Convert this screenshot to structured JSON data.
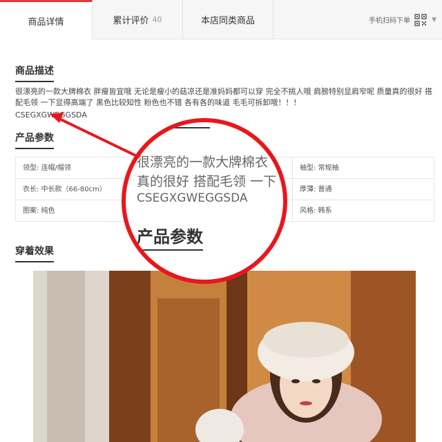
{
  "tabs": [
    {
      "label": "商品详情",
      "count": "",
      "active": true
    },
    {
      "label": "累计评价",
      "count": "40",
      "active": false
    },
    {
      "label": "本店同类商品",
      "count": "",
      "active": false
    }
  ],
  "qr": {
    "label": "手机扫码下单"
  },
  "description": {
    "title": "商品描述",
    "text": "很漂亮的一款大牌棉衣 胖瘦皆宜哦 无论是瘦小的菇凉还是准妈妈都可以穿 完全不挑人哦 肩膀特别显肩窄呢 质量真的很好 搭配毛领 一下显得高端了 黑色比较知性 粉色也不错 各有各的味道 毛毛可拆卸哦！！！",
    "code": "CSEGXGWEGGSDA"
  },
  "params": {
    "title": "产品参数",
    "rows": [
      [
        "领型: 连帽/帽领",
        "",
        "袖型: 常规袖"
      ],
      [
        "衣长: 中长款（66-80cm）",
        "",
        "厚薄: 普通"
      ],
      [
        "图案: 纯色",
        "",
        "风格: 韩系"
      ]
    ]
  },
  "wearing": {
    "title": "穿着效果"
  },
  "magnifier": {
    "line1": "很漂亮的一款大牌棉衣",
    "line2": "真的很好 搭配毛领 一下",
    "code": "CSEGXGWEGGSDA",
    "title": "产品参数"
  },
  "colors": {
    "accent": "#e4393c",
    "highlight": "#e8171c"
  }
}
